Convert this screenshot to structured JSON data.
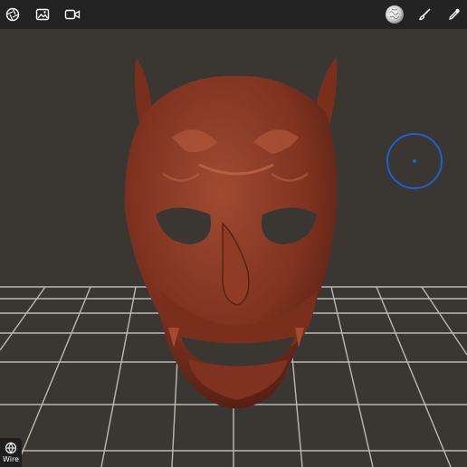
{
  "toolbar": {
    "left_icons": [
      "camera-aperture-icon",
      "image-icon",
      "video-camera-icon"
    ],
    "right_icons": [
      "material-sphere-icon",
      "brush-icon",
      "eyedropper-icon"
    ]
  },
  "viewport": {
    "background_color": "#3a3733",
    "grid_color": "#d8d8d8",
    "model_color": "#8a3a25",
    "cursor_color": "#1f5fd6"
  },
  "bottom_left": {
    "wire_label": "Wire",
    "icon": "wireframe-icon"
  }
}
